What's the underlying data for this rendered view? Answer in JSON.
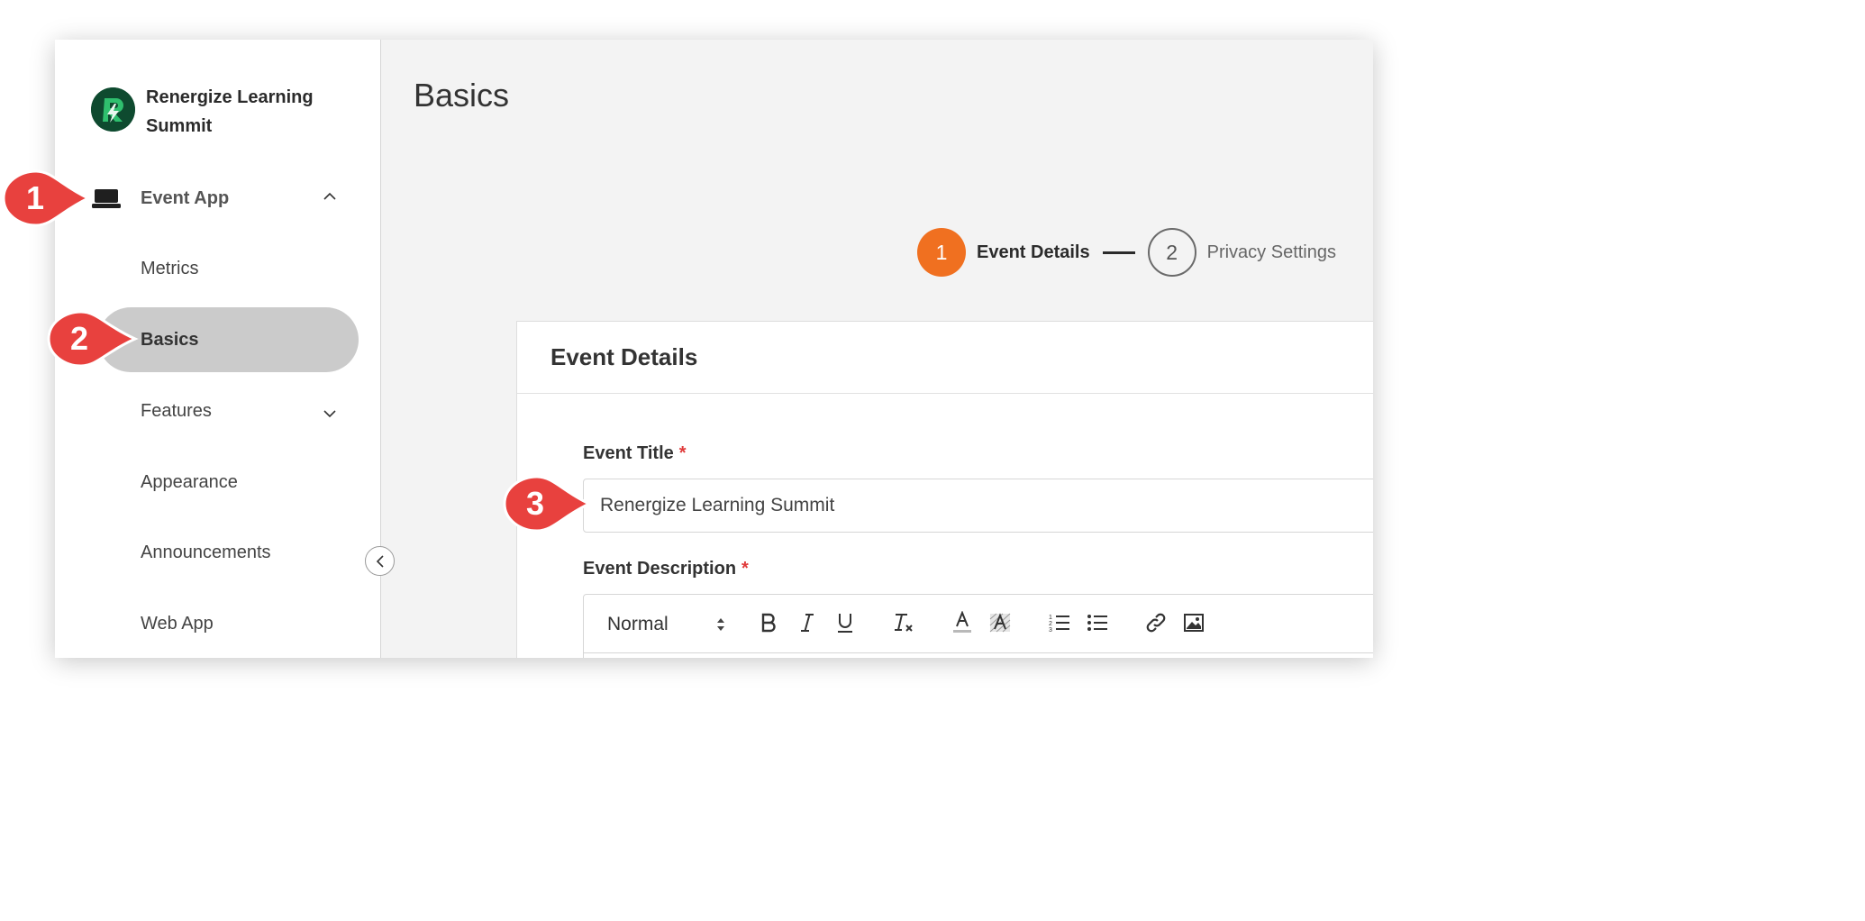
{
  "event": {
    "name": "Renergize Learning Summit"
  },
  "sidebar": {
    "group_label": "Event App",
    "items": [
      "Metrics",
      "Basics",
      "Features",
      "Appearance",
      "Announcements",
      "Web App"
    ]
  },
  "page": {
    "title": "Basics"
  },
  "stepper": {
    "steps": [
      {
        "number": "1",
        "label": "Event Details",
        "state": "active"
      },
      {
        "number": "2",
        "label": "Privacy Settings",
        "state": "inactive"
      }
    ]
  },
  "card": {
    "title": "Event Details",
    "title_field": {
      "label": "Event Title",
      "required_mark": "*",
      "value": "Renergize Learning Summit"
    },
    "description_field": {
      "label": "Event Description",
      "required_mark": "*"
    },
    "editor_toolbar": {
      "format_value": "Normal",
      "buttons": [
        "bold",
        "italic",
        "underline",
        "clear-format",
        "text-color",
        "background-color",
        "ordered-list",
        "bullet-list",
        "link",
        "image"
      ]
    }
  },
  "annotations": [
    "1",
    "2",
    "3"
  ],
  "colors": {
    "accent": "#f07020",
    "callout": "#e8413e",
    "brand": "#0e4a2f",
    "active_pill": "#cbcbcb",
    "required": "#e03a3a"
  }
}
